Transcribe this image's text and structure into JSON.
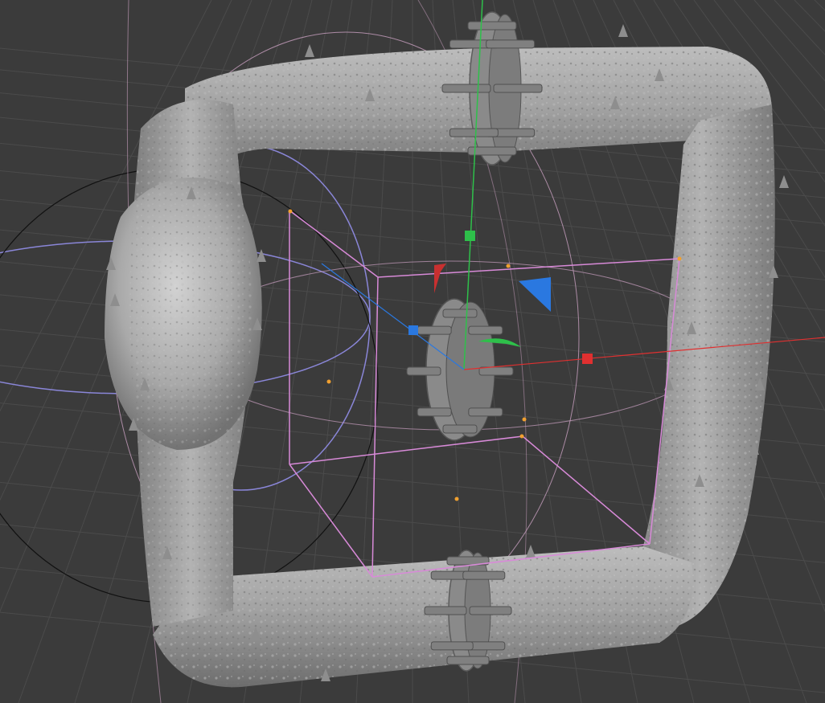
{
  "viewport": {
    "background": "#3b3b3b",
    "grid_color": "#4a4a4a",
    "grid_fine_color": "#444444"
  },
  "colors": {
    "pipe": "#9a9a9a",
    "pipe_dark": "#6f6f6f",
    "pipe_highlight": "#c8c8c8",
    "flange": "#8c8c8c",
    "bolt": "#7d7d7d",
    "axis_x": "#e03030",
    "axis_y": "#2ec04a",
    "axis_z": "#2a78e0",
    "selection_box": "#d88ad8",
    "guide_ring": "#c9a0c0",
    "sphere_ring": "#8a86d8",
    "point": "#f0a030"
  },
  "objects": {
    "pipe_loop": "pipe-frame",
    "center_flange": "flange-selected",
    "gizmo": "move-gizmo"
  }
}
